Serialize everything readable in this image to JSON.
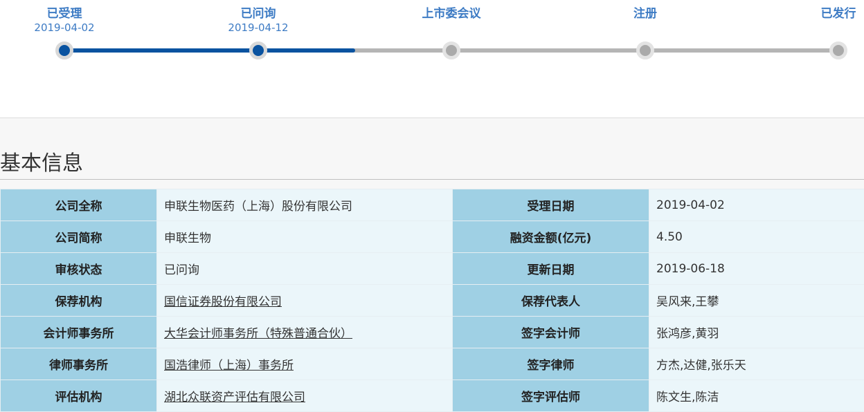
{
  "steps": [
    {
      "label": "已受理",
      "date": "2019-04-02",
      "status": "done"
    },
    {
      "label": "已问询",
      "date": "2019-04-12",
      "status": "done"
    },
    {
      "label": "上市委会议",
      "date": "",
      "status": "todo"
    },
    {
      "label": "注册",
      "date": "",
      "status": "todo"
    },
    {
      "label": "已发行",
      "date": "",
      "status": "todo"
    }
  ],
  "section_title": "基本信息",
  "rows": [
    {
      "l1": "公司全称",
      "v1": "申联生物医药（上海）股份有限公司",
      "l2": "受理日期",
      "v2": "2019-04-02"
    },
    {
      "l1": "公司简称",
      "v1": "申联生物",
      "l2": "融资金额(亿元)",
      "v2": "4.50"
    },
    {
      "l1": "审核状态",
      "v1": "已问询",
      "l2": "更新日期",
      "v2": "2019-06-18"
    },
    {
      "l1": "保荐机构",
      "v1": "国信证券股份有限公司",
      "l2": "保荐代表人",
      "v2": "吴风来,王攀"
    },
    {
      "l1": "会计师事务所",
      "v1": "大华会计师事务所（特殊普通合伙）",
      "l2": "签字会计师",
      "v2": "张鸿彦,黄羽"
    },
    {
      "l1": "律师事务所",
      "v1": "国浩律师（上海）事务所",
      "l2": "签字律师",
      "v2": "方杰,达健,张乐天"
    },
    {
      "l1": "评估机构",
      "v1": "湖北众联资产评估有限公司",
      "l2": "签字评估师",
      "v2": "陈文生,陈洁"
    }
  ],
  "colors": {
    "accent": "#0a53a0",
    "label_bg": "#9fd0e4",
    "value_bg": "#ebf6fa",
    "step_text": "#3d7bc4"
  }
}
